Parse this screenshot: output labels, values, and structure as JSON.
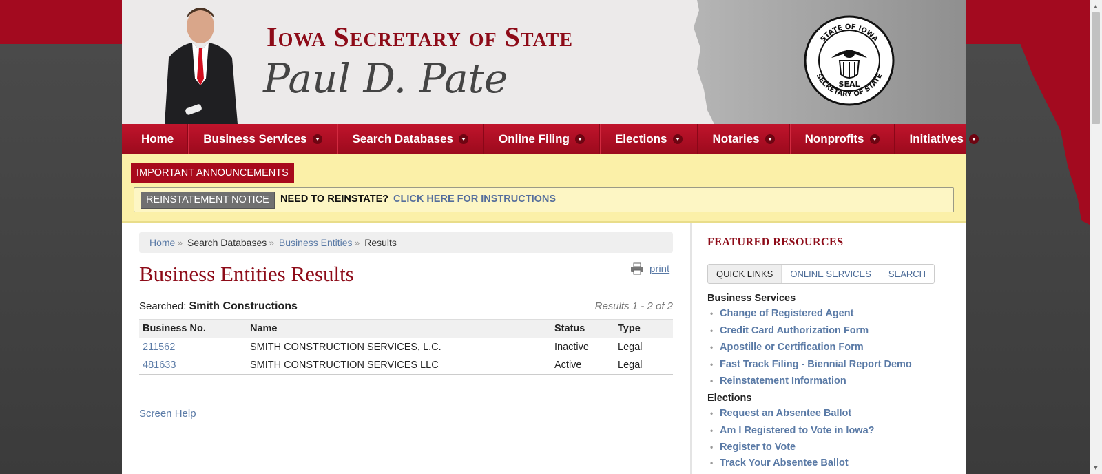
{
  "header": {
    "title_line1": "Iowa Secretary of State",
    "title_line2": "Paul D. Pate",
    "seal_text_top": "STATE OF IOWA",
    "seal_text_bottom": "SECRETARY OF STATE",
    "seal_center": "SEAL"
  },
  "nav": {
    "items": [
      {
        "label": "Home"
      },
      {
        "label": "Business Services"
      },
      {
        "label": "Search Databases"
      },
      {
        "label": "Online Filing"
      },
      {
        "label": "Elections"
      },
      {
        "label": "Notaries"
      },
      {
        "label": "Nonprofits"
      },
      {
        "label": "Initiatives"
      }
    ]
  },
  "announcements": {
    "badge": "IMPORTANT ANNOUNCEMENTS",
    "tag": "REINSTATEMENT NOTICE",
    "question": "NEED TO REINSTATE?",
    "link": "CLICK HERE FOR INSTRUCTIONS"
  },
  "breadcrumb": {
    "home": "Home",
    "search": "Search Databases",
    "entities": "Business Entities",
    "current": "Results",
    "sep": "»"
  },
  "main": {
    "title": "Business Entities Results",
    "print_label": "print",
    "searched_label": "Searched:",
    "searched_value": "Smith Constructions",
    "results_count": "Results 1 - 2 of 2",
    "screen_help": "Screen Help"
  },
  "table": {
    "headers": [
      "Business No.",
      "Name",
      "Status",
      "Type"
    ],
    "rows": [
      {
        "number": "211562",
        "name": "SMITH CONSTRUCTION SERVICES, L.C.",
        "status": "Inactive",
        "type": "Legal"
      },
      {
        "number": "481633",
        "name": "SMITH CONSTRUCTION SERVICES LLC",
        "status": "Active",
        "type": "Legal"
      }
    ]
  },
  "sidebar": {
    "title": "FEATURED RESOURCES",
    "tabs": [
      "QUICK LINKS",
      "ONLINE SERVICES",
      "SEARCH"
    ],
    "business_heading": "Business Services",
    "business_links": [
      "Change of Registered Agent",
      "Credit Card Authorization Form",
      "Apostille or Certification Form",
      "Fast Track Filing - Biennial Report Demo",
      "Reinstatement Information"
    ],
    "elections_heading": "Elections",
    "elections_links": [
      "Request an Absentee Ballot",
      "Am I Registered to Vote in Iowa?",
      "Register to Vote",
      "Track Your Absentee Ballot"
    ]
  },
  "colors": {
    "brand_red": "#8d0b18",
    "nav_red": "#b00f24",
    "link_blue": "#5a7aa6",
    "announce_bg": "#fbf0a8"
  }
}
